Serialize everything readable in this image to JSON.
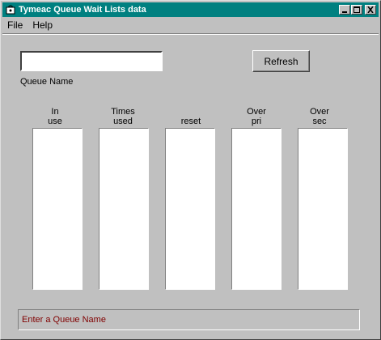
{
  "window": {
    "title": "Tymeac Queue Wait Lists data"
  },
  "menu": {
    "file": "File",
    "help": "Help"
  },
  "queue": {
    "value": "",
    "label": "Queue Name"
  },
  "refresh_label": "Refresh",
  "columns": [
    {
      "line1": "In",
      "line2": "use"
    },
    {
      "line1": "Times",
      "line2": "used"
    },
    {
      "line1": "",
      "line2": "reset"
    },
    {
      "line1": "Over",
      "line2": "pri"
    },
    {
      "line1": "Over",
      "line2": "sec"
    }
  ],
  "status": "Enter a Queue Name",
  "icons": {
    "app": "app-icon",
    "minimize": "minimize-icon",
    "maximize": "maximize-icon",
    "close": "close-icon"
  },
  "colors": {
    "titlebar": "#008080",
    "status_text": "#800000",
    "background": "#c0c0c0"
  }
}
